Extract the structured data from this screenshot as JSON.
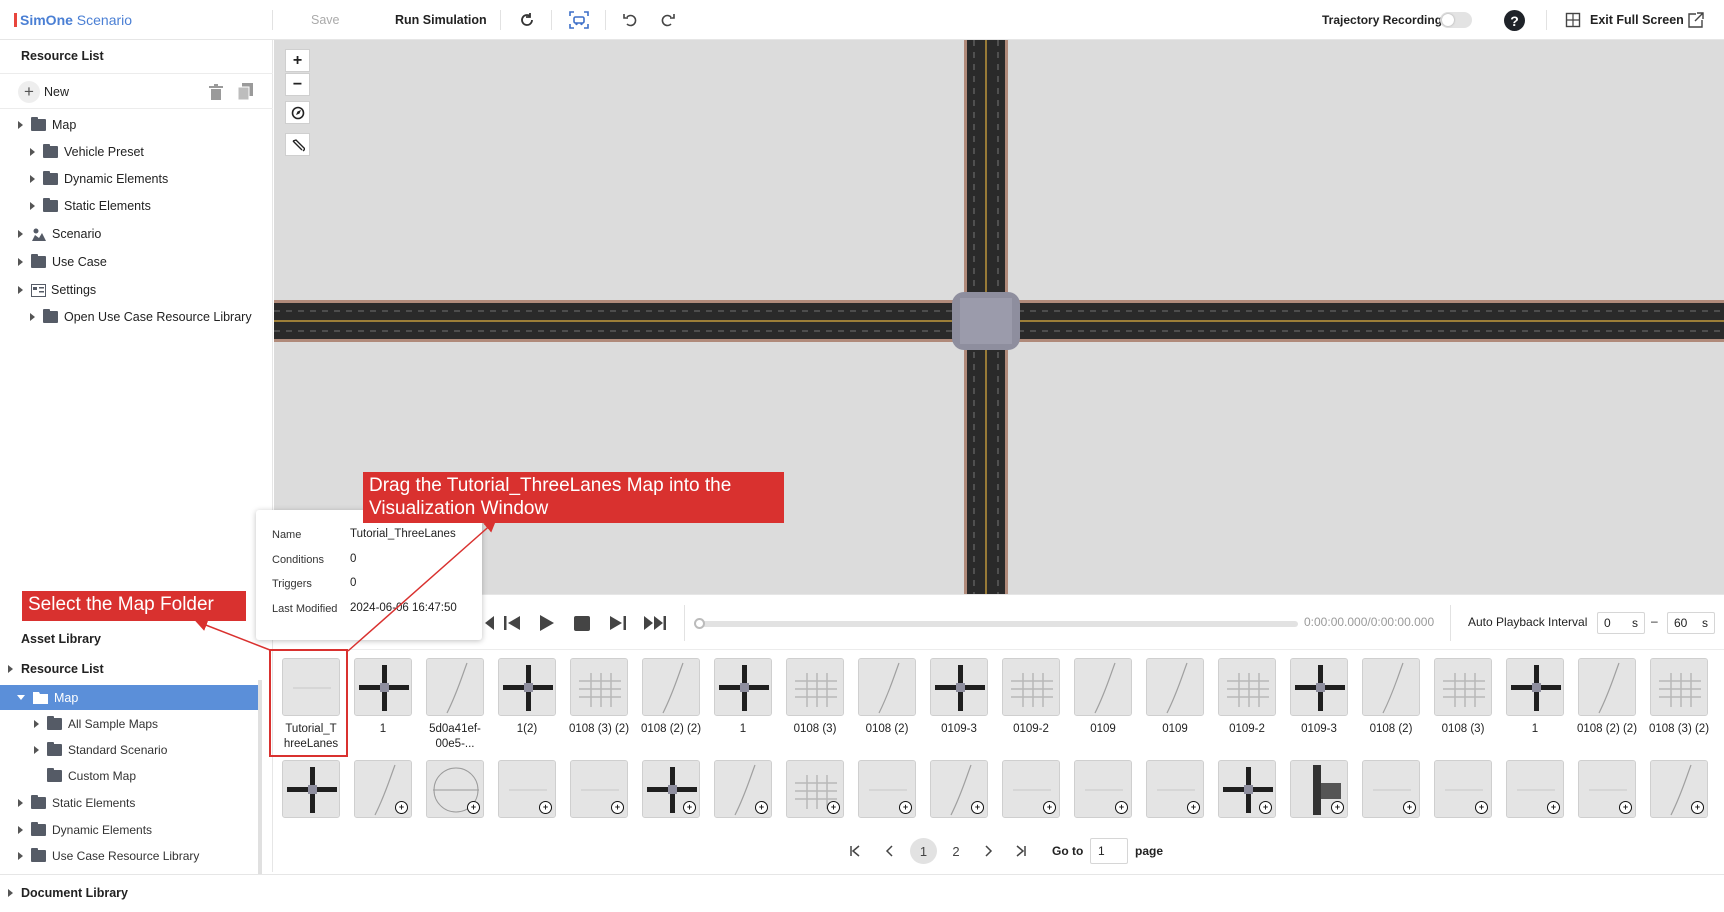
{
  "topbar": {
    "app_brand": "SimOne",
    "app_name": " Scenario",
    "save_label": "Save",
    "run_label": "Run Simulation",
    "trajectory_label": "Trajectory Recording",
    "exit_label": "Exit Full Screen",
    "icons": [
      "refresh-icon",
      "vehicle-view-icon",
      "undo-icon",
      "redo-icon",
      "help-icon",
      "fullscreen-icon",
      "external-icon"
    ]
  },
  "resource_panel": {
    "title": "Resource List",
    "new_label": "New",
    "items": [
      {
        "label": "Map",
        "level": 0
      },
      {
        "label": "Vehicle Preset",
        "level": 1
      },
      {
        "label": "Dynamic Elements",
        "level": 1
      },
      {
        "label": "Static Elements",
        "level": 1
      },
      {
        "label": "Scenario",
        "level": 0
      },
      {
        "label": "Use Case",
        "level": 0
      },
      {
        "label": "Settings",
        "level": 0
      },
      {
        "label": "Open Use Case Resource Library",
        "level": 1
      }
    ]
  },
  "asset_panel": {
    "title": "Asset Library",
    "items": [
      {
        "label": "Resource List"
      },
      {
        "label": "Map"
      },
      {
        "label": "All Sample Maps"
      },
      {
        "label": "Standard Scenario"
      },
      {
        "label": "Custom Map"
      },
      {
        "label": "Static Elements"
      },
      {
        "label": "Dynamic Elements"
      },
      {
        "label": "Use Case Resource Library"
      }
    ],
    "document_library": "Document Library"
  },
  "viewport": {
    "zoom_in": "+",
    "zoom_out": "−"
  },
  "playback": {
    "time": "0:00:00.000/0:00:00.000",
    "interval_label": "Auto Playback Interval",
    "from_value": "0",
    "to_value": "60",
    "unit": "s",
    "dash": "–"
  },
  "assets_row1": [
    "Tutorial_T hreeLanes",
    "1",
    "5d0a41ef-00e5-...",
    "1(2)",
    "0108 (3) (2)",
    "0108 (2) (2)",
    "1",
    "0108 (3)",
    "0108 (2)",
    "0109-3",
    "0109-2",
    "0109",
    "0109",
    "0109-2",
    "0109-3",
    "0108 (2)",
    "0108 (3)",
    "1",
    "0108 (2) (2)",
    "0108 (3) (2)"
  ],
  "pagination": {
    "page1": "1",
    "page2": "2",
    "goto_label": "Go to",
    "goto_value": "1",
    "page_label": "page"
  },
  "tooltip": {
    "name_key": "Name",
    "name_val": "Tutorial_ThreeLanes",
    "cond_key": "Conditions",
    "cond_val": "0",
    "trig_key": "Triggers",
    "trig_val": "0",
    "mod_key": "Last Modified",
    "mod_val": "2024-06-06 16:47:50"
  },
  "annotations": {
    "drag": "Drag the Tutorial_ThreeLanes Map into the Visualization Window",
    "select": "Select the Map Folder"
  },
  "colors": {
    "accent": "#4a7fd4",
    "selected_row": "#5b8fd9",
    "callout": "#d9312f",
    "brand_bar": "#e8453c"
  }
}
